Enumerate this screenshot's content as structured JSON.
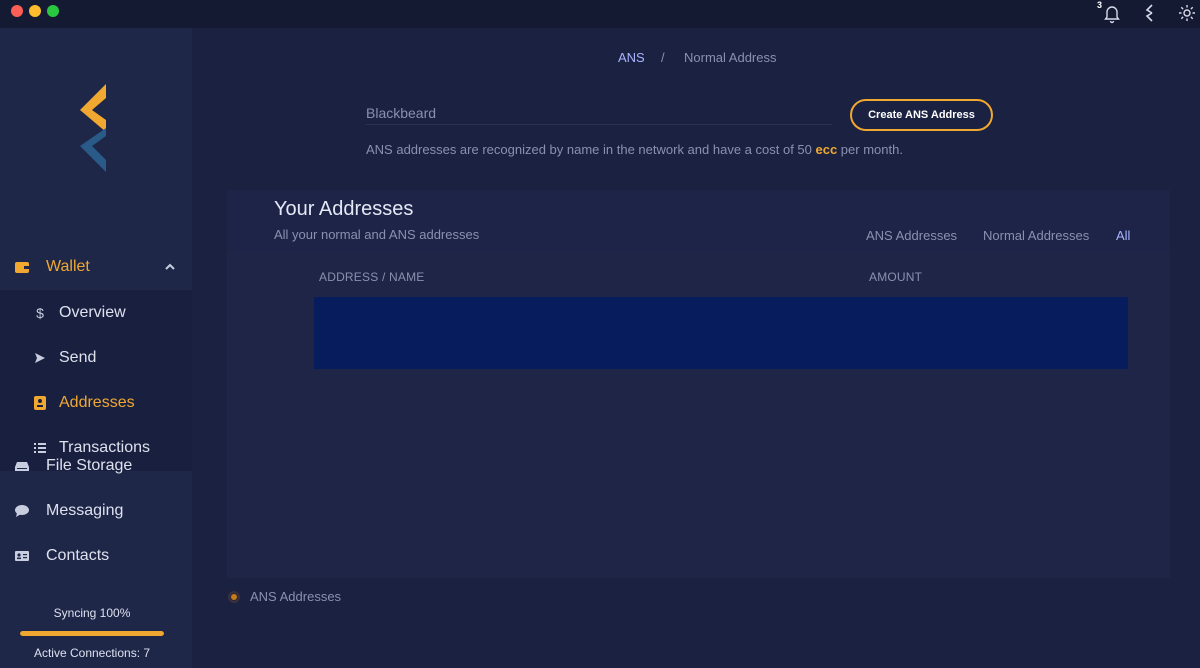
{
  "titlebar": {
    "notification_count": "3",
    "icons": [
      "bell-icon",
      "ecc-logo-icon",
      "gear-icon"
    ]
  },
  "sidebar": {
    "wallet": {
      "label": "Wallet",
      "icon": "wallet-icon"
    },
    "wallet_items": [
      {
        "label": "Overview",
        "icon": "dollar-icon"
      },
      {
        "label": "Send",
        "icon": "send-icon"
      },
      {
        "label": "Addresses",
        "icon": "address-book-icon"
      },
      {
        "label": "Transactions",
        "icon": "list-icon"
      }
    ],
    "items": [
      {
        "label": "File Storage",
        "icon": "hard-drive-icon"
      },
      {
        "label": "Messaging",
        "icon": "chat-bubble-icon"
      },
      {
        "label": "Contacts",
        "icon": "contact-card-icon"
      }
    ],
    "sync_label": "Syncing 100%",
    "sync_progress": 1.0,
    "connections_label": "Active Connections: 7"
  },
  "main": {
    "breadcrumb": {
      "active": "ANS",
      "separator": "/",
      "other": "Normal Address"
    },
    "name_input": {
      "placeholder": "Blackbeard",
      "value": ""
    },
    "create_button": "Create ANS Address",
    "info": {
      "before": "ANS addresses are recognized by name in the network and have a cost of 50 ",
      "currency": "ecc",
      "after": " per month."
    },
    "panel": {
      "title": "Your Addresses",
      "subtitle": "All your normal and ANS addresses",
      "filters": {
        "ans": "ANS Addresses",
        "normal": "Normal Addresses",
        "all": "All"
      },
      "columns": {
        "address": "ADDRESS / NAME",
        "amount": "AMOUNT"
      }
    },
    "legend": "ANS Addresses"
  },
  "colors": {
    "accent": "#f0a830",
    "link": "#a9b4ff",
    "background": "#1b2140",
    "sidebar": "#1f2749",
    "selected_row": "#061c5c"
  }
}
